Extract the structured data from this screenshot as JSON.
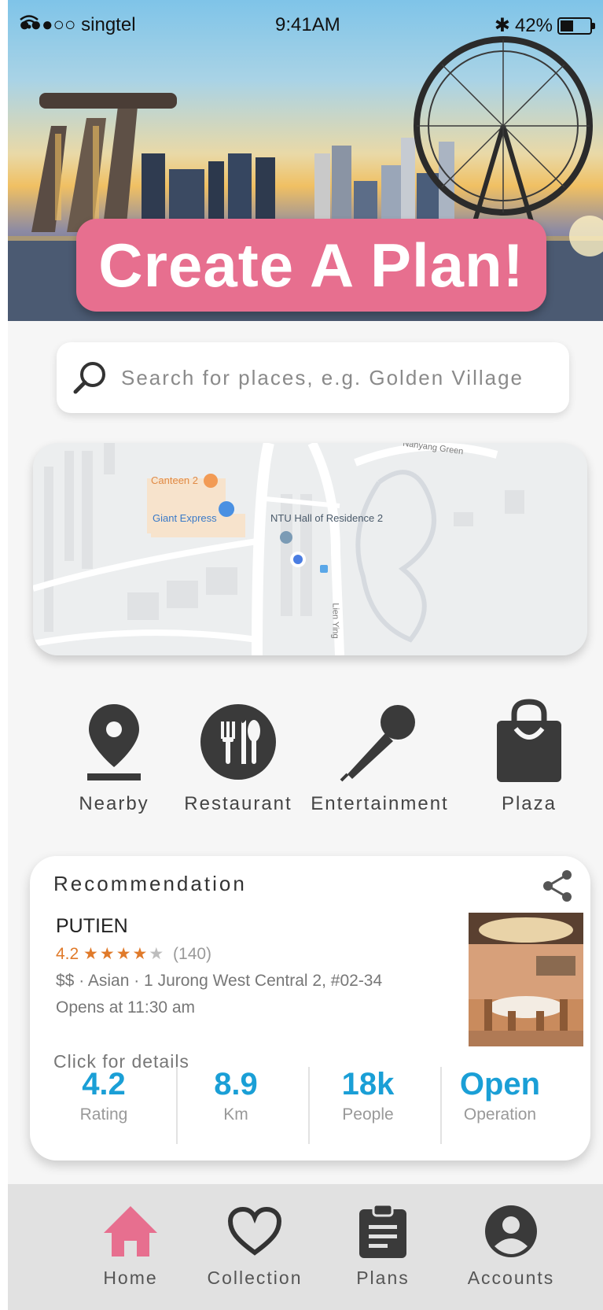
{
  "status_bar": {
    "carrier": "●●●○○ singtel",
    "time": "9:41AM",
    "battery": "42%"
  },
  "hero": {
    "cta_label": "Create A Plan!"
  },
  "search": {
    "placeholder": "Search for places, e.g. Golden Village"
  },
  "map": {
    "labels": {
      "canteen": "Canteen 2",
      "giant": "Giant Express",
      "hall": "NTU Hall of Residence 2",
      "green": "Nanyang Green",
      "road": "Lien Ying"
    }
  },
  "categories": [
    {
      "label": "Nearby",
      "icon": "location-pin-icon"
    },
    {
      "label": "Restaurant",
      "icon": "utensils-icon"
    },
    {
      "label": "Entertainment",
      "icon": "microphone-icon"
    },
    {
      "label": "Plaza",
      "icon": "shopping-bag-icon"
    }
  ],
  "recommendation": {
    "title": "Recommendation",
    "name": "PUTIEN",
    "rating": "4.2",
    "stars_filled": "★★★★",
    "stars_empty": "★",
    "review_count": "(140)",
    "meta": "$$ · Asian · 1 Jurong West Central 2, #02-34",
    "hours": "Opens at 11:30 am",
    "click_hint": "Click for details",
    "stats": [
      {
        "value": "4.2",
        "label": "Rating"
      },
      {
        "value": "8.9",
        "label": "Km"
      },
      {
        "value": "18k",
        "label": "People"
      },
      {
        "value": "Open",
        "label": "Operation"
      }
    ]
  },
  "nav": [
    {
      "label": "Home",
      "icon": "home-icon",
      "active": true,
      "color": "#e76f8f"
    },
    {
      "label": "Collection",
      "icon": "heart-icon",
      "active": false,
      "color": "#333333"
    },
    {
      "label": "Plans",
      "icon": "clipboard-icon",
      "active": false,
      "color": "#333333"
    },
    {
      "label": "Accounts",
      "icon": "account-circle-icon",
      "active": false,
      "color": "#333333"
    }
  ],
  "colors": {
    "accent": "#e76f8f",
    "stat_blue": "#1a9fd6",
    "dark_icon": "#3a3a3a"
  }
}
